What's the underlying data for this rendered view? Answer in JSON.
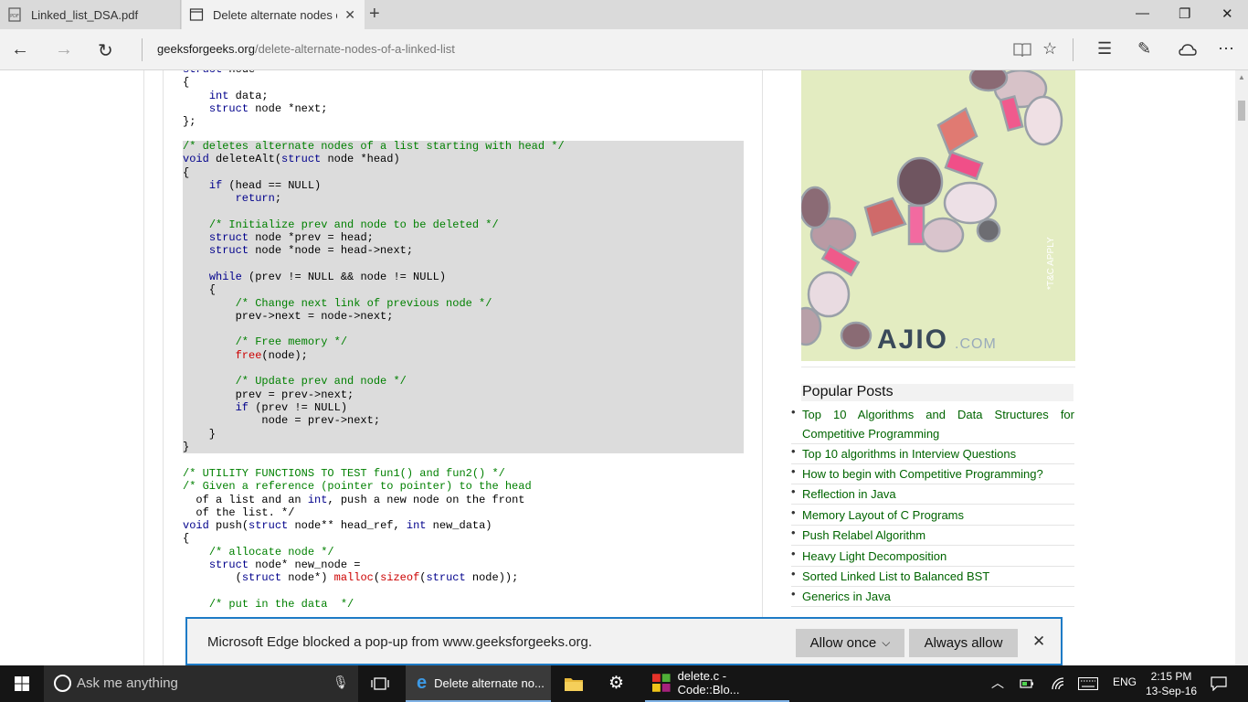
{
  "browser": {
    "tabs": [
      {
        "label": "Linked_list_DSA.pdf",
        "icon": "pdf-icon"
      },
      {
        "label": "Delete alternate nodes o",
        "icon": "page-icon"
      }
    ],
    "url_domain": "geeksforgeeks.org",
    "url_path": "/delete-alternate-nodes-of-a-linked-list"
  },
  "code": {
    "top_lines": [
      "struct node",
      "{",
      "    int data;",
      "    struct node *next;",
      "};"
    ],
    "highlighted_lines": [
      "/* deletes alternate nodes of a list starting with head */",
      "void deleteAlt(struct node *head)",
      "{",
      "    if (head == NULL)",
      "        return;",
      "",
      "    /* Initialize prev and node to be deleted */",
      "    struct node *prev = head;",
      "    struct node *node = head->next;",
      "",
      "    while (prev != NULL && node != NULL)",
      "    {",
      "        /* Change next link of previous node */",
      "        prev->next = node->next;",
      "",
      "        /* Free memory */",
      "        free(node);",
      "",
      "        /* Update prev and node */",
      "        prev = prev->next;",
      "        if (prev != NULL)",
      "            node = prev->next;",
      "    }",
      "}"
    ],
    "bottom_lines": [
      "/* UTILITY FUNCTIONS TO TEST fun1() and fun2() */",
      "/* Given a reference (pointer to pointer) to the head",
      "  of a list and an int, push a new node on the front",
      "  of the list. */",
      "void push(struct node** head_ref, int new_data)",
      "{",
      "    /* allocate node */",
      "    struct node* new_node =",
      "        (struct node*) malloc(sizeof(struct node));",
      "",
      "    /* put in the data  */"
    ]
  },
  "ad": {
    "brand": "AJIO",
    "brand_suffix": ".COM",
    "terms": "*T&C APPLY"
  },
  "popular": {
    "title": "Popular Posts",
    "items": [
      "Top 10 Algorithms and Data Structures for Competitive Programming",
      "Top 10 algorithms in Interview Questions",
      "How to begin with Competitive Programming?",
      "Reflection in Java",
      "Memory Layout of C Programs",
      "Push Relabel Algorithm",
      "Heavy Light Decomposition",
      "Sorted Linked List to Balanced BST",
      "Generics in Java"
    ]
  },
  "popup": {
    "message": "Microsoft Edge blocked a pop-up from www.geeksforgeeks.org.",
    "allow_once": "Allow once",
    "always_allow": "Always allow"
  },
  "taskbar": {
    "search_placeholder": "Ask me anything",
    "edge_label": "Delete alternate no...",
    "codeblocks_label": "delete.c - Code::Blo...",
    "language": "ENG",
    "time": "2:15 PM",
    "date": "13-Sep-16"
  }
}
